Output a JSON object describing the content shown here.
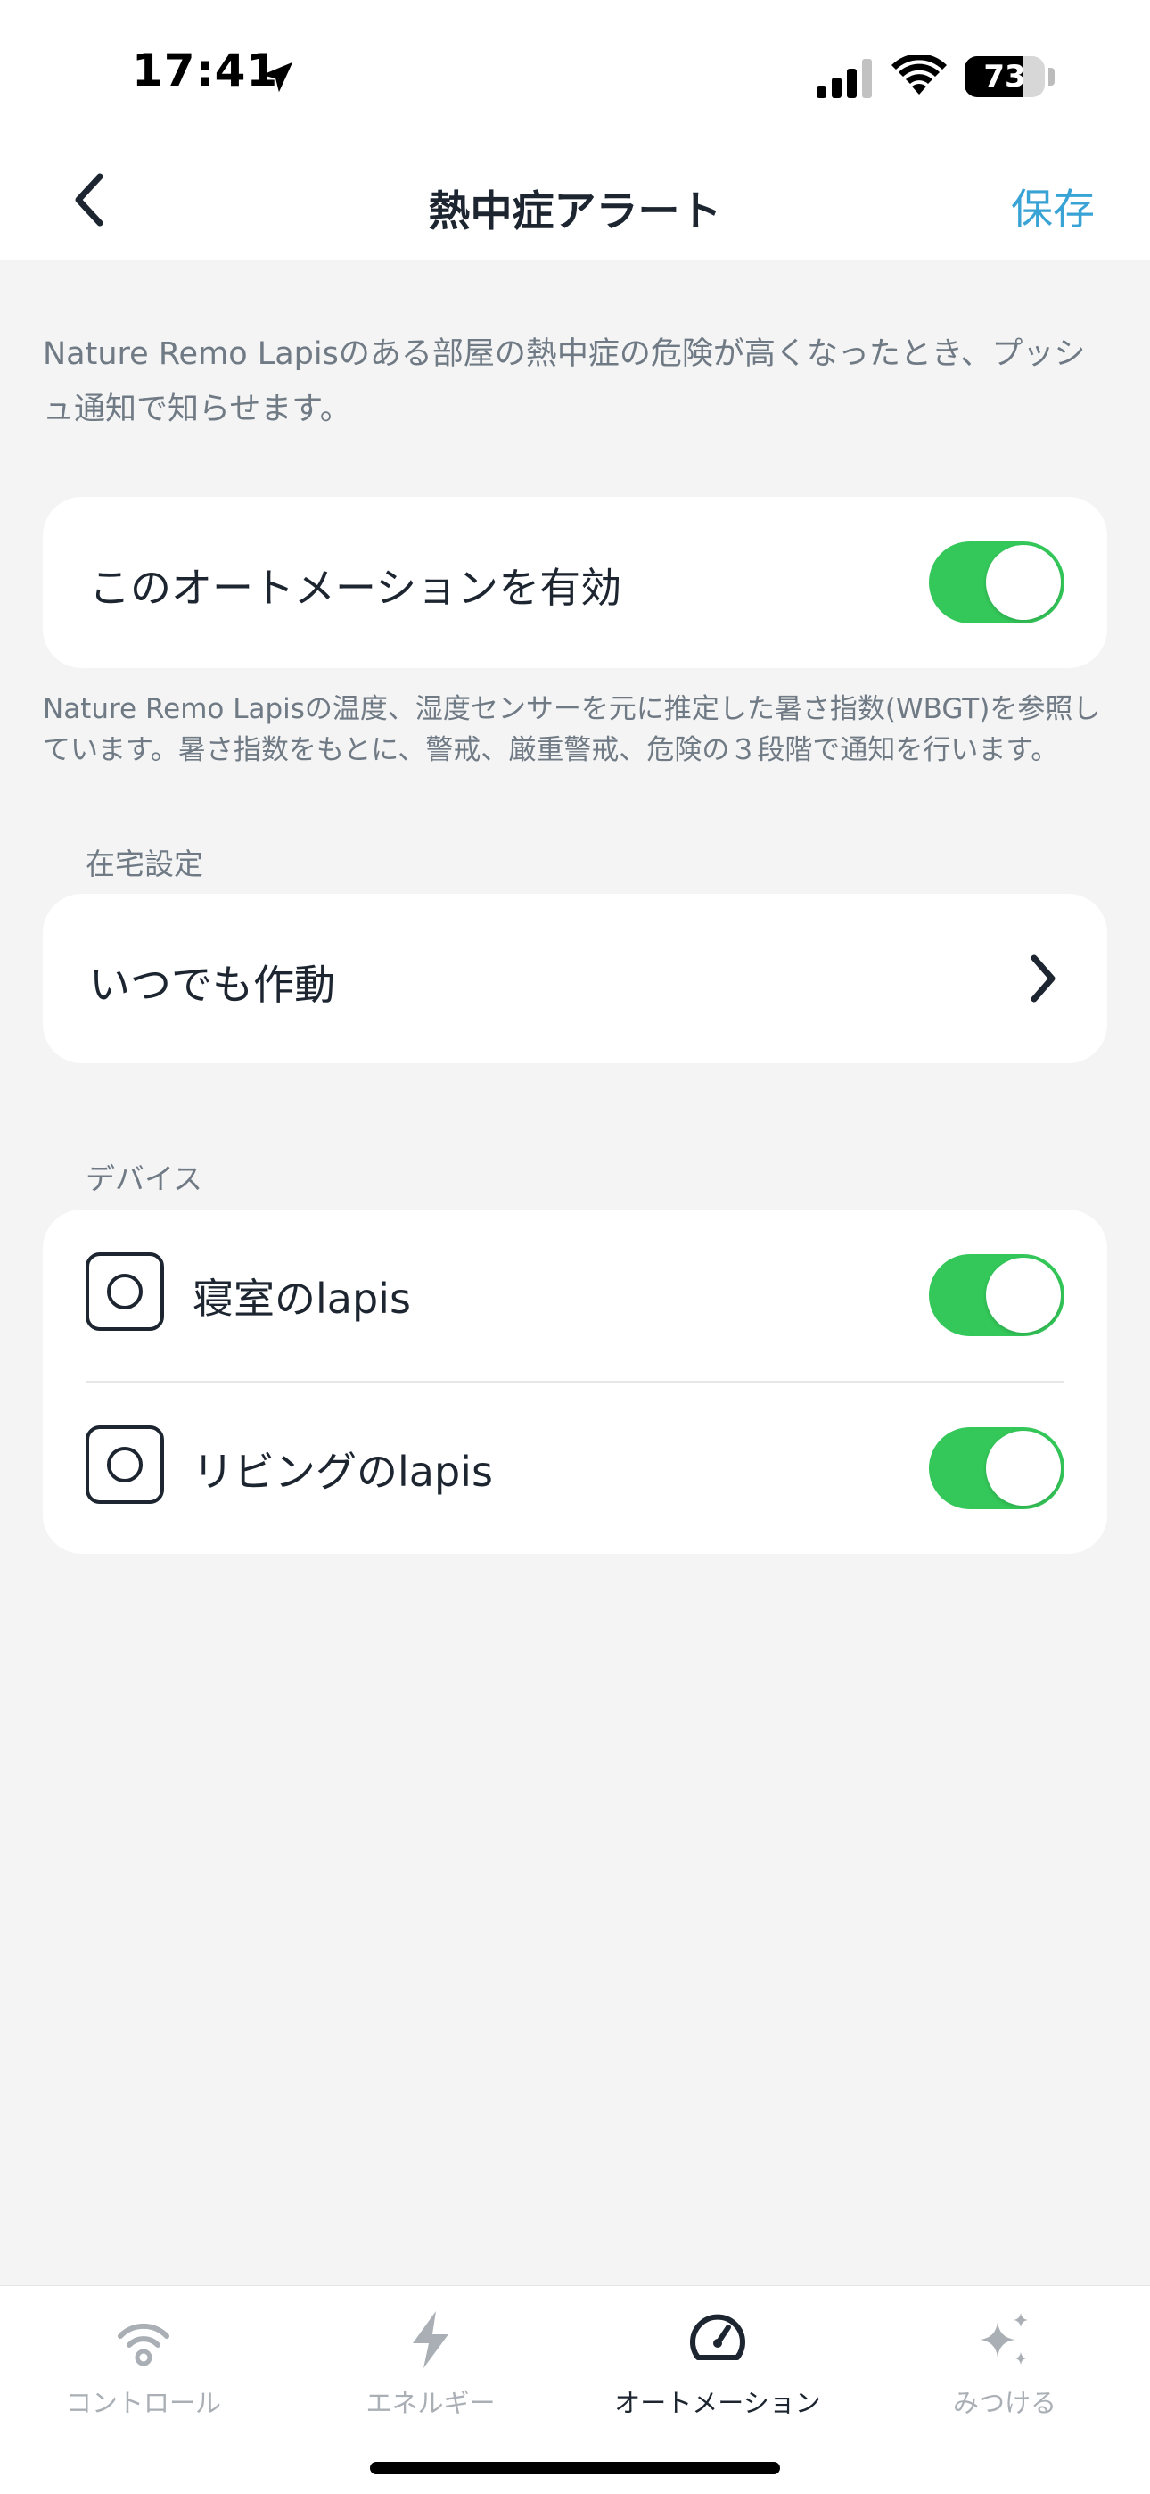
{
  "status_bar": {
    "time": "17:41",
    "battery_percent": "73",
    "battery_level": 0.73,
    "icons": [
      "location-arrow-icon",
      "signal-bars-icon",
      "wifi-icon",
      "battery-icon"
    ]
  },
  "nav": {
    "back_icon": "chevron-left-icon",
    "title": "熱中症アラート",
    "save_label": "保存"
  },
  "description": "Nature Remo Lapisのある部屋の熱中症の危険が高くなったとき、プッシュ通知で知らせます。",
  "automation": {
    "enable_label": "このオートメーションを有効",
    "enabled": true
  },
  "note": "Nature Remo Lapisの温度、湿度センサーを元に推定した暑さ指数(WBGT)を参照しています。暑さ指数をもとに、警戒、厳重警戒、危険の３段階で通知を行います。",
  "home_setting": {
    "section_label": "在宅設定",
    "value": "いつでも作動",
    "chevron_icon": "chevron-right-icon"
  },
  "devices": {
    "section_label": "デバイス",
    "items": [
      {
        "name": "寝室のlapis",
        "enabled": true,
        "icon": "lapis-device-icon"
      },
      {
        "name": "リビングのlapis",
        "enabled": true,
        "icon": "lapis-device-icon"
      }
    ]
  },
  "tab_bar": {
    "tabs": [
      {
        "label": "コントロール",
        "icon": "control-signal-icon",
        "active": false
      },
      {
        "label": "エネルギー",
        "icon": "lightning-bolt-icon",
        "active": false
      },
      {
        "label": "オートメーション",
        "icon": "automation-gauge-icon",
        "active": true
      },
      {
        "label": "みつける",
        "icon": "sparkles-icon",
        "active": false
      }
    ],
    "active_color": "#1c2530",
    "inactive_color": "#a9afb4"
  },
  "colors": {
    "accent": "#3aa3d6",
    "toggle_on": "#34c759",
    "background": "#f4f4f4",
    "text": "#1c2530",
    "secondary_text": "#6f7a85"
  }
}
